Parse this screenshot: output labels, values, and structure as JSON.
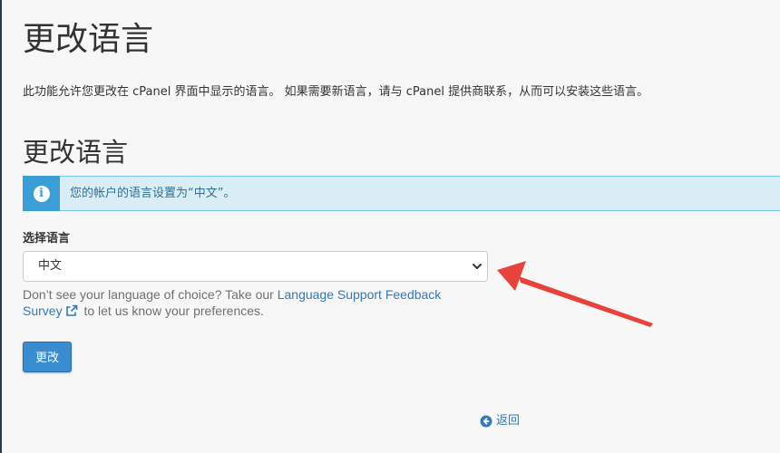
{
  "page": {
    "title": "更改语言",
    "description": "此功能允许您更改在 cPanel 界面中显示的语言。 如果需要新语言，请与 cPanel 提供商联系，从而可以安装这些语言。"
  },
  "section": {
    "title": "更改语言"
  },
  "alert": {
    "icon": "info-circle-icon",
    "text": "您的帐户的语言设置为“中文”。"
  },
  "language_select": {
    "label": "选择语言",
    "selected": "中文"
  },
  "help": {
    "prefix": "Don’t see your language of choice? Take our ",
    "link_text": "Language Support Feedback Survey",
    "suffix": " to let us know your preferences."
  },
  "actions": {
    "change_label": "更改",
    "back_label": "返回"
  },
  "colors": {
    "alert_bg": "#d9edf7",
    "alert_icon_bg": "#3a9fd6",
    "link": "#337ab7",
    "button_bg": "#3a8cd1",
    "annotation_arrow": "#e8423a"
  }
}
